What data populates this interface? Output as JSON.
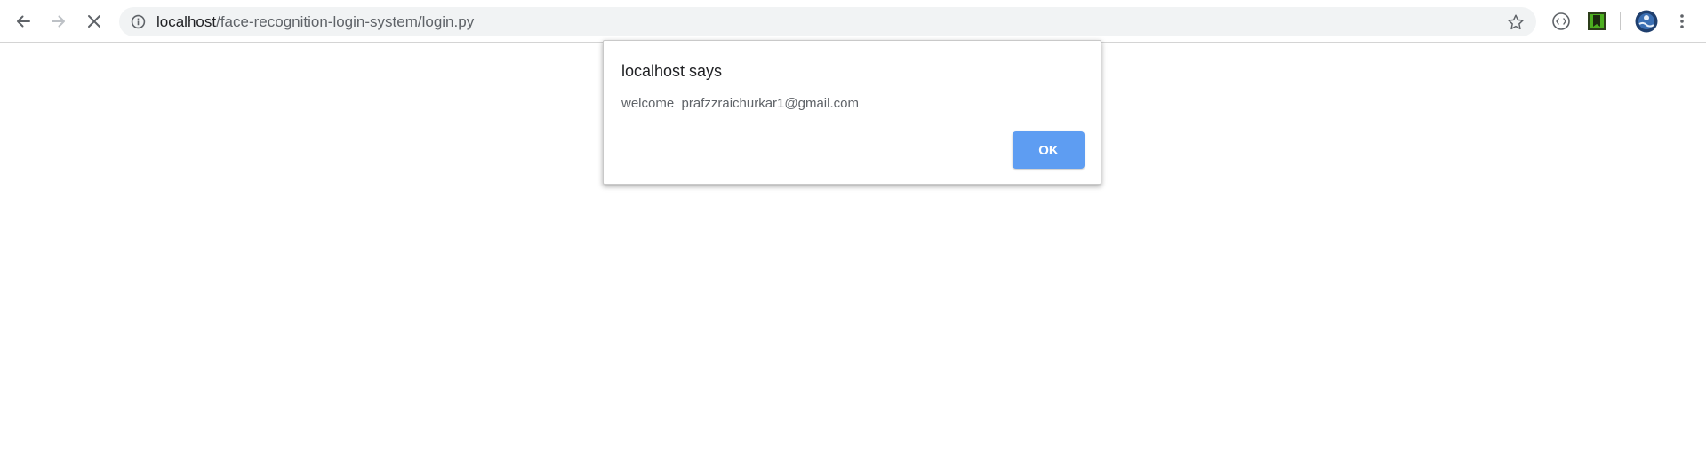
{
  "browser": {
    "url_host": "localhost",
    "url_path": "/face-recognition-login-system/login.py",
    "icons": {
      "back": "back-arrow-icon",
      "forward": "forward-arrow-icon",
      "stop": "stop-loading-icon",
      "site_info": "info-icon",
      "bookmark": "star-icon",
      "extension_1": "extension-icon",
      "extension_2": "bookmark-extension-icon",
      "profile": "profile-avatar-icon",
      "menu": "kebab-menu-icon"
    }
  },
  "dialog": {
    "title": "localhost says",
    "message": "welcome  prafzzraichurkar1@gmail.com",
    "ok_label": "OK",
    "ok_color": "#5e9df2"
  }
}
